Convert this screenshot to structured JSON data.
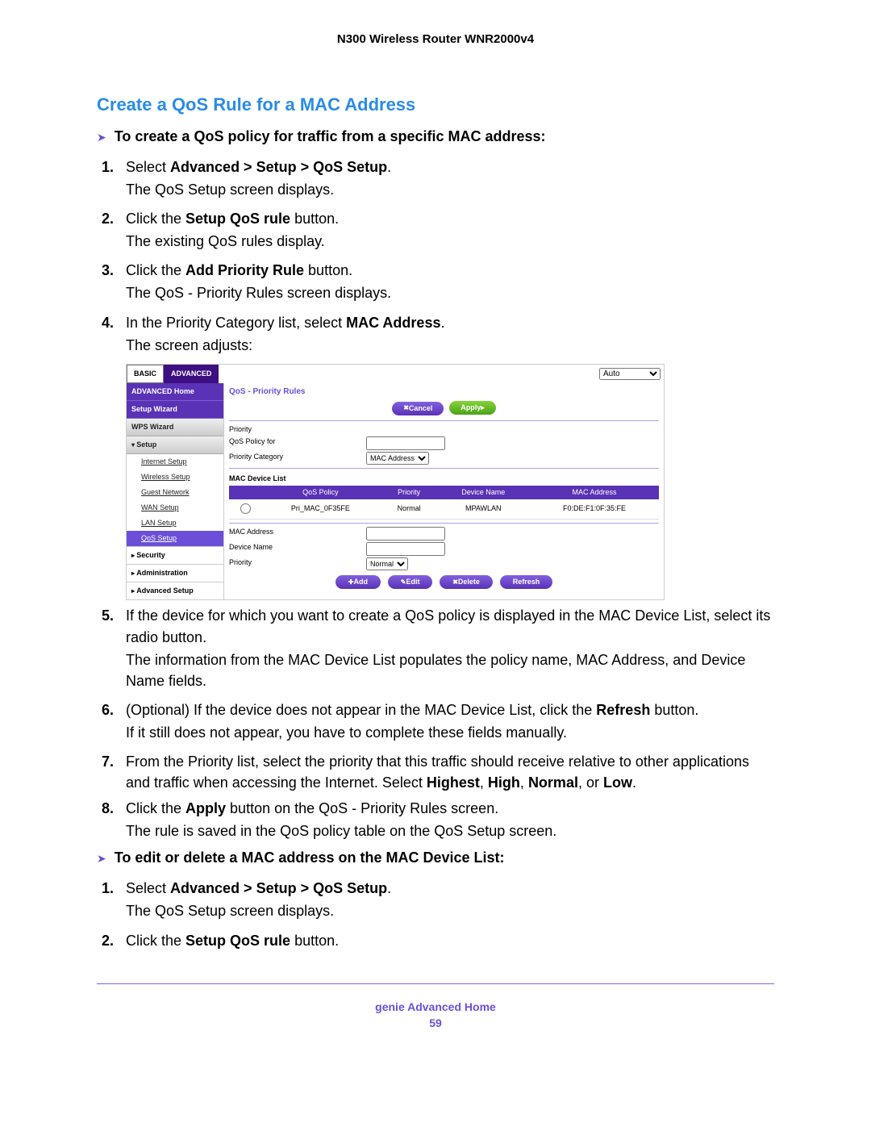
{
  "doc": {
    "header": "N300 Wireless Router WNR2000v4",
    "title": "Create a QoS Rule for a MAC Address",
    "lead1": "To create a QoS policy for traffic from a specific MAC address:",
    "steps": [
      {
        "pre": "Select ",
        "b": "Advanced > Setup > QoS Setup",
        "post": ".",
        "sub": "The QoS Setup screen displays."
      },
      {
        "pre": "Click the ",
        "b": "Setup QoS rule",
        "post": " button.",
        "sub": "The existing QoS rules display."
      },
      {
        "pre": "Click the ",
        "b": "Add Priority Rule",
        "post": " button.",
        "sub": "The QoS - Priority Rules screen displays."
      },
      {
        "pre": "In the Priority Category list, select ",
        "b": "MAC Address",
        "post": ".",
        "sub": "The screen adjusts:"
      }
    ],
    "step5": "If the device for which you want to create a QoS policy is displayed in the MAC Device List, select its radio button.",
    "step5b": "The information from the MAC Device List populates the policy name, MAC Address, and Device Name fields.",
    "step6_pre": "(Optional) If the device does not appear in the MAC Device List, click the ",
    "step6_b": "Refresh",
    "step6_post": " button.",
    "step6b": "If it still does not appear, you have to complete these fields manually.",
    "step7_pre": "From the Priority list, select the priority that this traffic should receive relative to other applications and traffic when accessing the Internet. Select ",
    "step7_b": "Highest",
    "step7_mid1": ", ",
    "step7_b2": "High",
    "step7_mid2": ", ",
    "step7_b3": "Normal",
    "step7_mid3": ", or ",
    "step7_b4": "Low",
    "step7_post": ".",
    "step8_pre": "Click the ",
    "step8_b": "Apply",
    "step8_post": " button on the QoS - Priority Rules screen.",
    "step8b": "The rule is saved in the QoS policy table on the QoS Setup screen.",
    "lead2": "To edit or delete a MAC address on the MAC Device List:",
    "steps2": [
      {
        "pre": "Select ",
        "b": "Advanced > Setup > QoS Setup",
        "post": ".",
        "sub": "The QoS Setup screen displays."
      },
      {
        "pre": "Click the ",
        "b": "Setup QoS rule",
        "post": " button."
      }
    ],
    "footer_section": "genie Advanced Home",
    "footer_page": "59"
  },
  "ui": {
    "tabs": {
      "basic": "BASIC",
      "advanced": "ADVANCED"
    },
    "auto_option": "Auto",
    "sidebar": {
      "adv_home": "ADVANCED Home",
      "setup_wizard": "Setup Wizard",
      "wps_wizard": "WPS Wizard",
      "setup": "Setup",
      "items": [
        "Internet Setup",
        "Wireless Setup",
        "Guest Network",
        "WAN Setup",
        "LAN Setup",
        "QoS Setup"
      ],
      "security": "Security",
      "administration": "Administration",
      "advanced_setup": "Advanced Setup"
    },
    "panel": {
      "title": "QoS - Priority Rules",
      "cancel": "Cancel",
      "apply": "Apply",
      "priority_lbl": "Priority",
      "qos_policy_lbl": "QoS Policy for",
      "pri_cat_lbl": "Priority Category",
      "pri_cat_val": "MAC Address",
      "mac_list_hdr": "MAC Device List",
      "th_policy": "QoS Policy",
      "th_priority": "Priority",
      "th_device": "Device Name",
      "th_mac": "MAC Address",
      "row": {
        "policy": "Pri_MAC_0F35FE",
        "priority": "Normal",
        "device": "MPAWLAN",
        "mac": "F0:DE:F1:0F:35:FE"
      },
      "mac_addr_lbl": "MAC Address",
      "dev_name_lbl": "Device Name",
      "pri_lbl": "Priority",
      "pri_val": "Normal",
      "add": "Add",
      "edit": "Edit",
      "delete": "Delete",
      "refresh": "Refresh"
    }
  }
}
